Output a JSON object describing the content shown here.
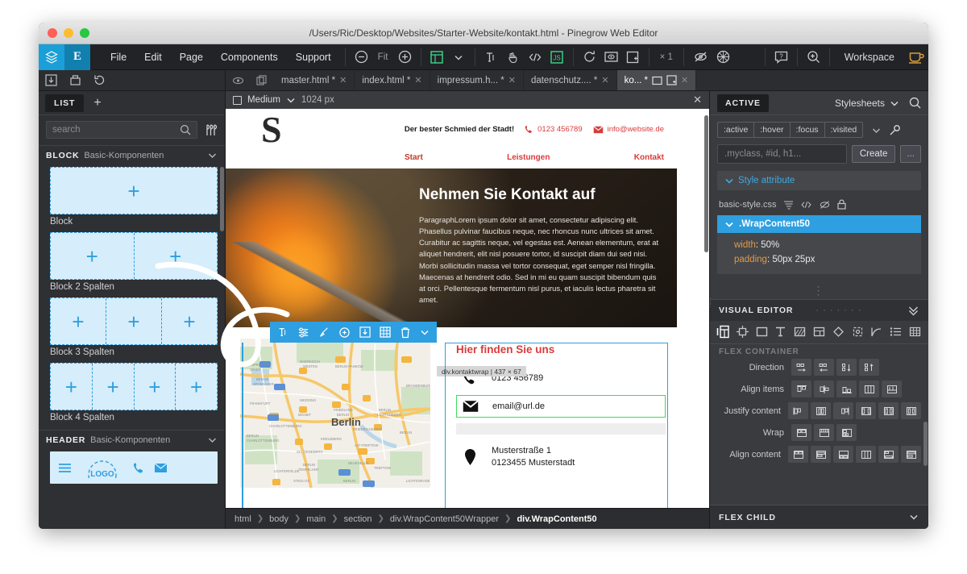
{
  "window": {
    "title": "/Users/Ric/Desktop/Websites/Starter-Website/kontakt.html - Pinegrow Web Editor"
  },
  "toolbar": {
    "menus": [
      "File",
      "Edit",
      "Page",
      "Components",
      "Support"
    ],
    "zoom_out": "zoom-out-icon",
    "fit_label": "Fit",
    "zoom_in": "zoom-in-icon",
    "multiply_label": "× 1",
    "workspace_label": "Workspace"
  },
  "tabbar": {
    "tabs": [
      {
        "label": "master.html *",
        "active": false
      },
      {
        "label": "index.html *",
        "active": false
      },
      {
        "label": "impressum.h... *",
        "active": false
      },
      {
        "label": "datenschutz.... *",
        "active": false
      },
      {
        "label": "ko... *",
        "active": true
      }
    ]
  },
  "left_panel": {
    "tab_label": "LIST",
    "add_label": "+",
    "search_placeholder": "search",
    "search_value": "",
    "sections": [
      {
        "category": "BLOCK",
        "subtitle": "Basic-Komponenten",
        "items": [
          {
            "label": "Block",
            "columns": 1
          },
          {
            "label": "Block 2 Spalten",
            "columns": 2
          },
          {
            "label": "Block 3 Spalten",
            "columns": 3
          },
          {
            "label": "Block 4 Spalten",
            "columns": 4
          }
        ]
      },
      {
        "category": "HEADER",
        "subtitle": "Basic-Komponenten",
        "items": [
          {
            "label": "LOGO",
            "columns": 0
          }
        ]
      }
    ]
  },
  "canvas": {
    "device_label": "Medium",
    "device_width": "1024 px",
    "close": "close-icon"
  },
  "website": {
    "logo": "S",
    "claim": "Der bester Schmied der Stadt!",
    "phone": "0123 456789",
    "email": "info@website.de",
    "nav": [
      "Start",
      "Leistungen",
      "Kontakt"
    ],
    "hero_title": "Nehmen Sie Kontakt auf",
    "hero_paragraph": "ParagraphLorem ipsum dolor sit amet, consectetur adipiscing elit. Phasellus pulvinar faucibus neque, nec rhoncus nunc ultrices sit amet. Curabitur ac sagittis neque, vel egestas est. Aenean elementum, erat at aliquet hendrerit, elit nisl posuere tortor, id suscipit diam dui sed nisi. Morbi sollicitudin massa vel tortor consequat, eget semper nisl fringilla. Maecenas at hendrerit odio. Sed in mi eu quam suscipit bibendum quis at orci. Pellentesque fermentum nisl purus, et iaculis lectus pharetra sit amet.",
    "contact_title": "Hier finden Sie uns",
    "contact_phone": "0123 456789",
    "contact_email": "email@url.de",
    "contact_address_line1": "Musterstraße 1",
    "contact_address_line2": "0123455 Musterstadt",
    "map_city": "Berlin",
    "selection_badge": "div.kontaktwrap | 437 × 67"
  },
  "breadcrumb": {
    "items": [
      "html",
      "body",
      "main",
      "section",
      "div.WrapContent50Wrapper",
      "div.WrapContent50"
    ]
  },
  "right_panel": {
    "tab_label": "ACTIVE",
    "stylesheets_label": "Stylesheets",
    "pseudo_classes": [
      ":active",
      ":hover",
      ":focus",
      ":visited"
    ],
    "selector_placeholder": ".myclass, #id, h1...",
    "selector_value": "",
    "create_label": "Create",
    "more_label": "...",
    "style_attribute_label": "Style attribute",
    "css_file": "basic-style.css",
    "rule": {
      "selector": ".WrapContent50",
      "declarations": [
        {
          "property": "width",
          "value": "50%"
        },
        {
          "property": "padding",
          "value": "50px 25px"
        }
      ]
    },
    "visual_editor": {
      "title": "VISUAL EDITOR",
      "section_label": "FLEX CONTAINER",
      "controls": [
        {
          "label": "Direction",
          "count": 4
        },
        {
          "label": "Align items",
          "count": 5
        },
        {
          "label": "Justify content",
          "count": 6
        },
        {
          "label": "Wrap",
          "count": 3
        },
        {
          "label": "Align content",
          "count": 6
        }
      ]
    },
    "flex_child_label": "FLEX CHILD"
  },
  "colors": {
    "accent_blue": "#2e9fe0",
    "brand_dark": "#1280ae",
    "site_red": "#d93b3b",
    "selection_green": "#3ddc5a",
    "panel_bg": "#3a3b3e",
    "toolbar_bg": "#222326"
  }
}
